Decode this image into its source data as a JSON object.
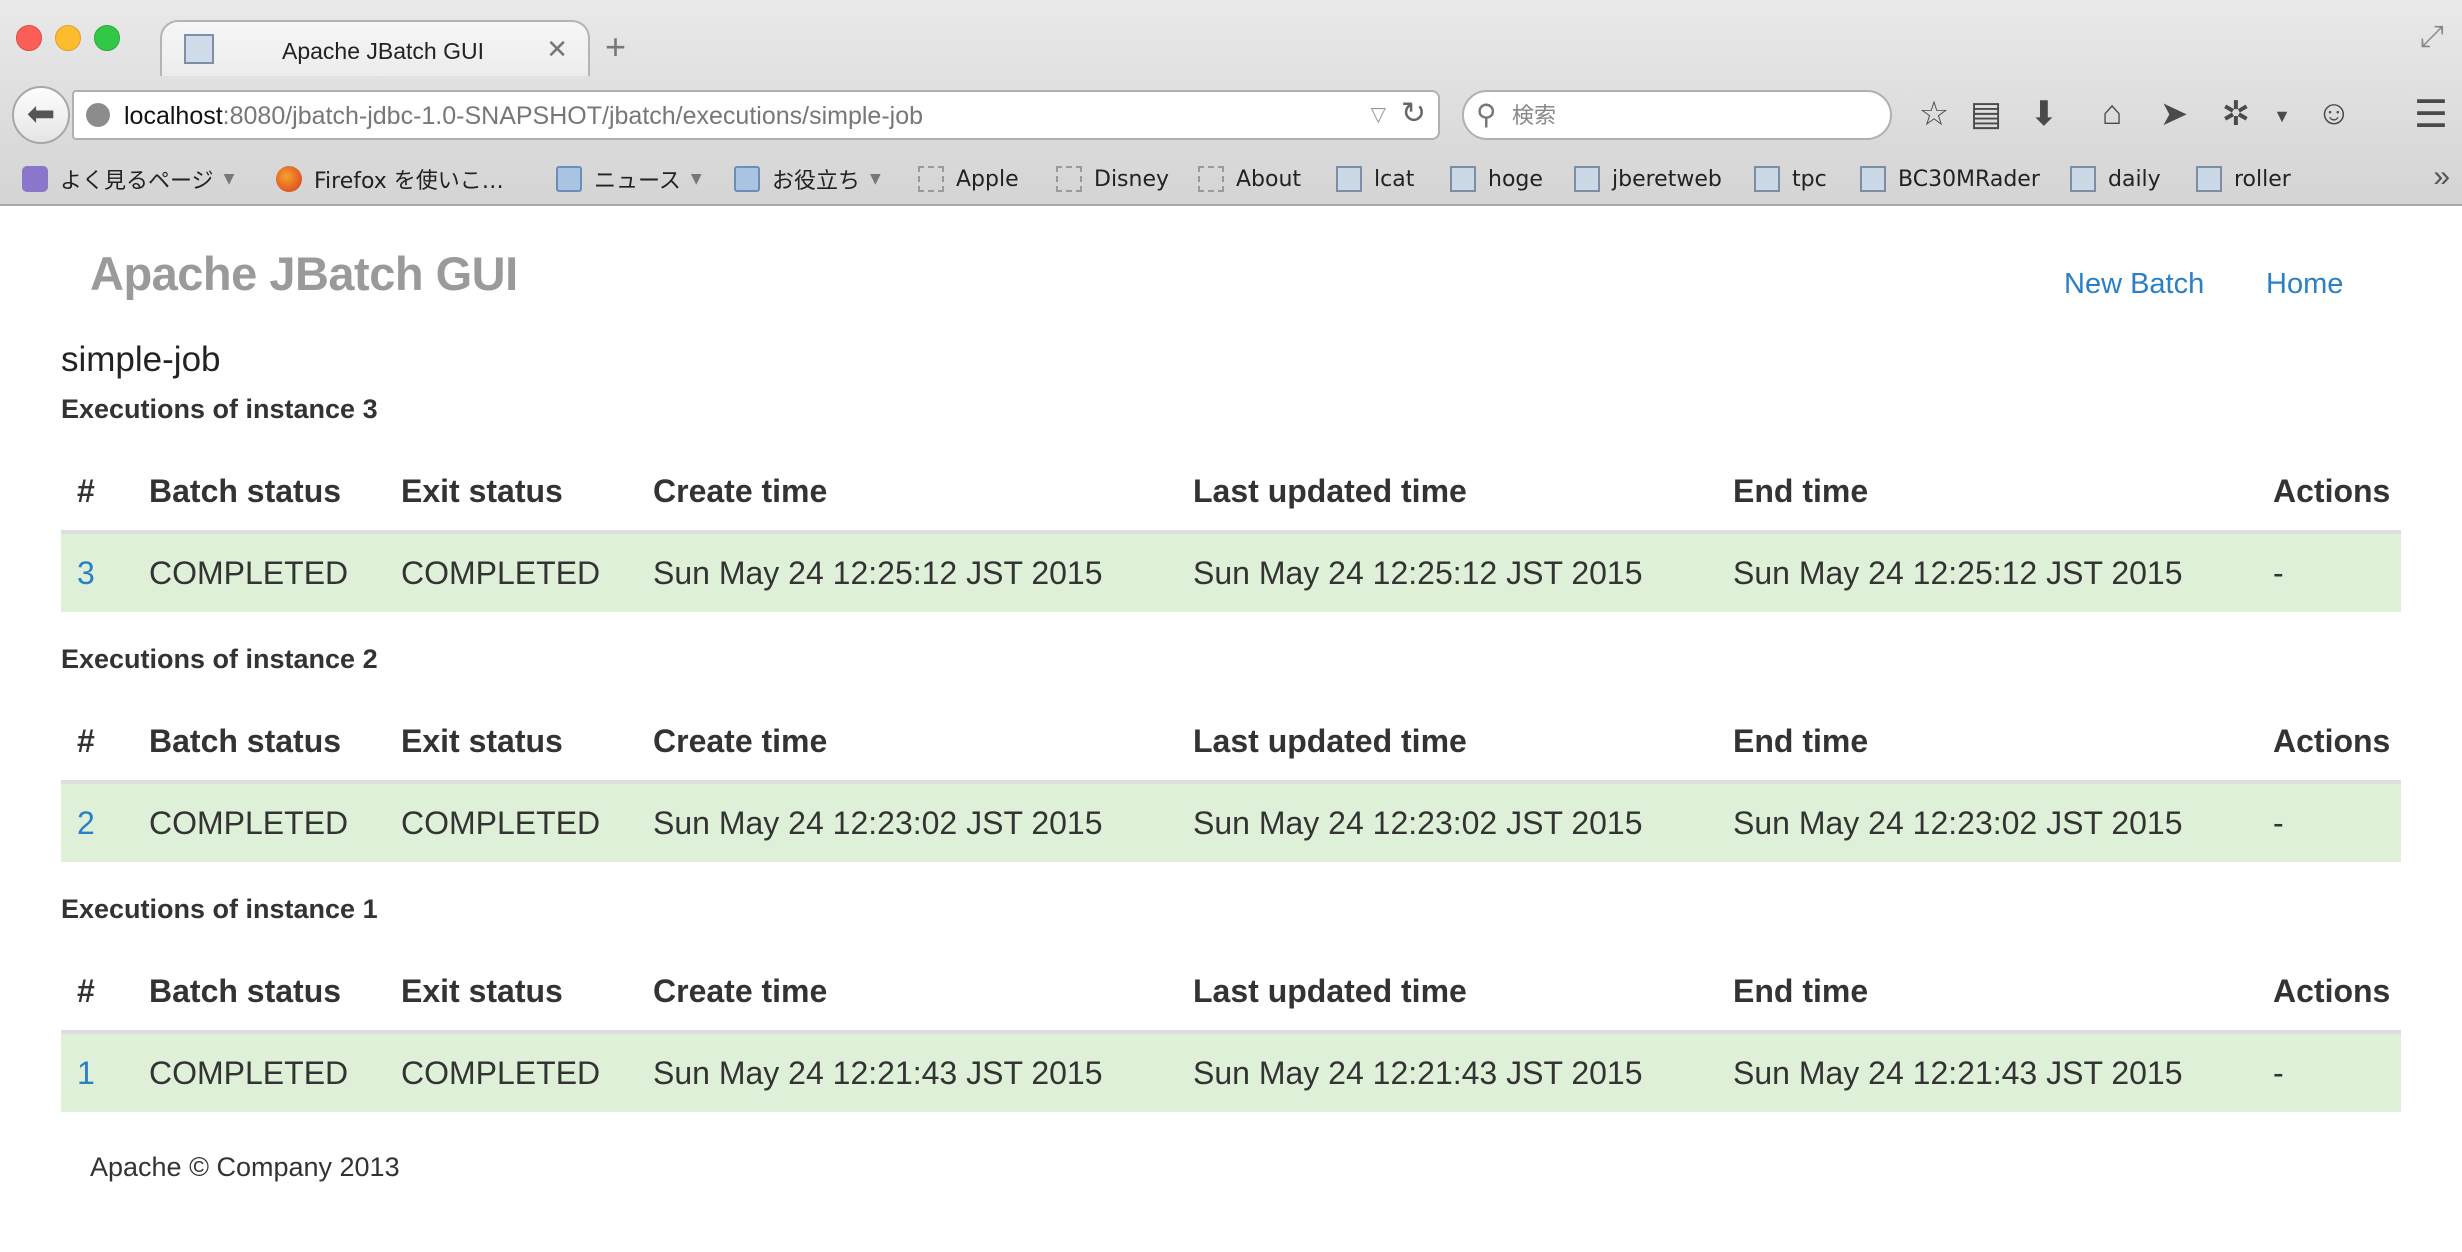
{
  "browser": {
    "tab_title": "Apache JBatch GUI",
    "tab_close": "✕",
    "new_tab": "+",
    "url_host": "localhost",
    "url_rest": ":8080/jbatch-jdbc-1.0-SNAPSHOT/jbatch/executions/simple-job",
    "search_placeholder": "検索",
    "bookmarks": [
      {
        "label": "よく見るページ",
        "icon": "star",
        "dropdown": true
      },
      {
        "label": "Firefox を使いこ…",
        "icon": "fox",
        "dropdown": false
      },
      {
        "label": "ニュース",
        "icon": "folder",
        "dropdown": true
      },
      {
        "label": "お役立ち",
        "icon": "folder",
        "dropdown": true
      },
      {
        "label": "Apple",
        "icon": "dashed",
        "dropdown": false
      },
      {
        "label": "Disney",
        "icon": "dashed",
        "dropdown": false
      },
      {
        "label": "About",
        "icon": "dashed",
        "dropdown": false
      },
      {
        "label": "lcat",
        "icon": "page",
        "dropdown": false
      },
      {
        "label": "hoge",
        "icon": "page",
        "dropdown": false
      },
      {
        "label": "jberetweb",
        "icon": "page",
        "dropdown": false
      },
      {
        "label": "tpc",
        "icon": "page",
        "dropdown": false
      },
      {
        "label": "BC30MRader",
        "icon": "page",
        "dropdown": false
      },
      {
        "label": "daily",
        "icon": "page",
        "dropdown": false
      },
      {
        "label": "roller",
        "icon": "page",
        "dropdown": false
      }
    ],
    "bookmarks_more": "»"
  },
  "page": {
    "brand": "Apache JBatch GUI",
    "nav": {
      "new_batch": "New Batch",
      "home": "Home"
    },
    "job_title": "simple-job",
    "table_headers": [
      "#",
      "Batch status",
      "Exit status",
      "Create time",
      "Last updated time",
      "End time",
      "Actions"
    ],
    "instances": [
      {
        "title": "Executions of instance 3",
        "row": {
          "id": "3",
          "batch_status": "COMPLETED",
          "exit_status": "COMPLETED",
          "create_time": "Sun May 24 12:25:12 JST 2015",
          "last_updated_time": "Sun May 24 12:25:12 JST 2015",
          "end_time": "Sun May 24 12:25:12 JST 2015",
          "actions": "-"
        }
      },
      {
        "title": "Executions of instance 2",
        "row": {
          "id": "2",
          "batch_status": "COMPLETED",
          "exit_status": "COMPLETED",
          "create_time": "Sun May 24 12:23:02 JST 2015",
          "last_updated_time": "Sun May 24 12:23:02 JST 2015",
          "end_time": "Sun May 24 12:23:02 JST 2015",
          "actions": "-"
        }
      },
      {
        "title": "Executions of instance 1",
        "row": {
          "id": "1",
          "batch_status": "COMPLETED",
          "exit_status": "COMPLETED",
          "create_time": "Sun May 24 12:21:43 JST 2015",
          "last_updated_time": "Sun May 24 12:21:43 JST 2015",
          "end_time": "Sun May 24 12:21:43 JST 2015",
          "actions": "-"
        }
      }
    ],
    "footer": "Apache © Company 2013"
  },
  "colors": {
    "link": "#2a7fc5",
    "success_row": "#dff0d8",
    "brand": "#9a9a9a"
  }
}
